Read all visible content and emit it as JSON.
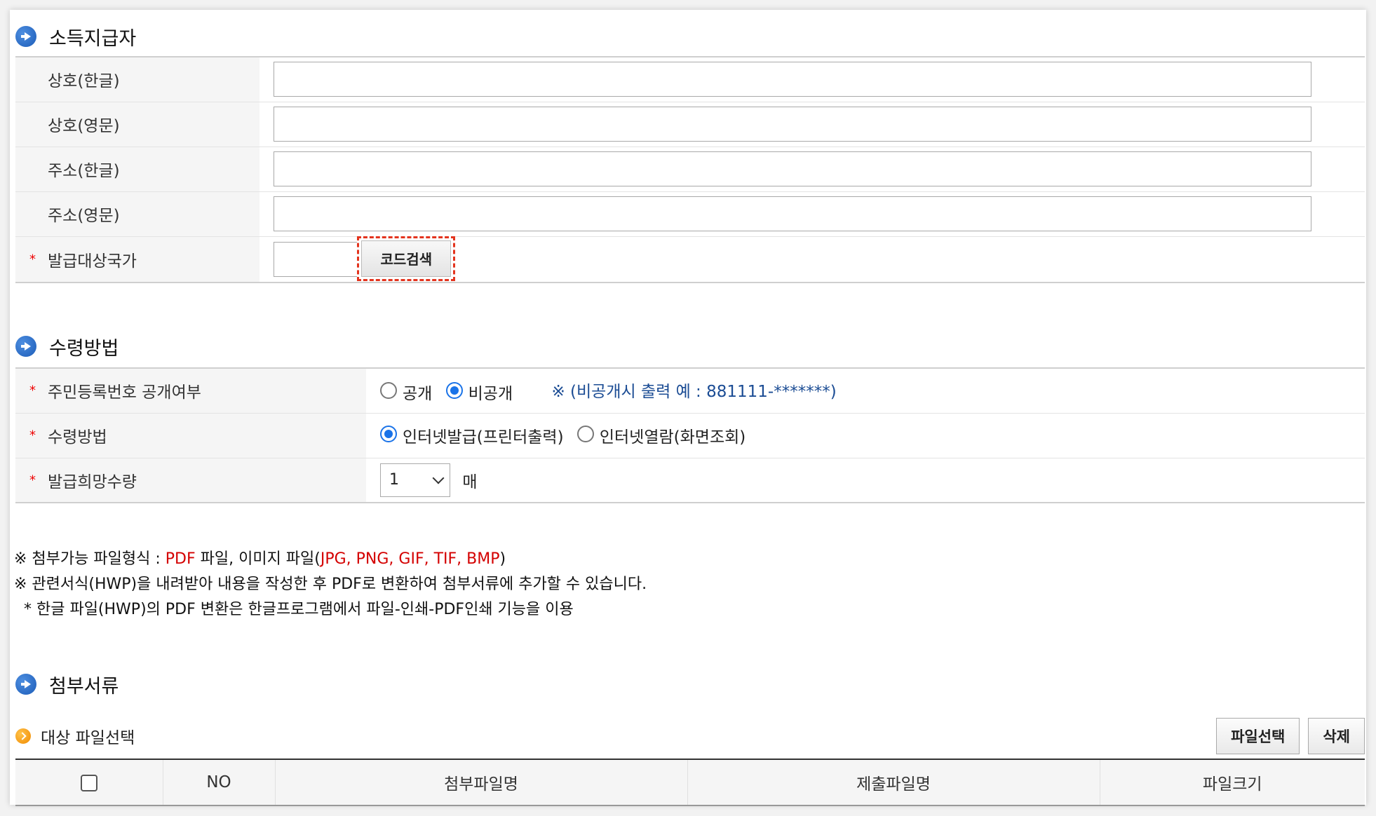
{
  "sections": {
    "payer": "소득지급자",
    "receipt": "수령방법",
    "attach": "첨부서류"
  },
  "payer_form": {
    "name_kr": "상호(한글)",
    "name_en": "상호(영문)",
    "addr_kr": "주소(한글)",
    "addr_en": "주소(영문)",
    "country": "발급대상국가",
    "code_search": "코드검색",
    "required_mark": "*"
  },
  "receipt_form": {
    "id_public_label": "주민등록번호 공개여부",
    "opt_public": "공개",
    "opt_private": "비공개",
    "private_note": "※ (비공개시 출력 예 : 881111-*******)",
    "method_label": "수령방법",
    "opt_internet_issue": "인터넷발급(프린터출력)",
    "opt_internet_view": "인터넷열람(화면조회)",
    "qty_label": "발급희망수량",
    "qty_value": "1",
    "qty_unit": "매"
  },
  "notes": {
    "line1_prefix": "※ 첨부가능 파일형식 : ",
    "line1_pdf": "PDF",
    "line1_mid": " 파일, 이미지 파일(",
    "line1_formats": "JPG, PNG, GIF, TIF, BMP",
    "line1_suffix": ")",
    "line2": "※ 관련서식(HWP)을 내려받아 내용을 작성한 후 PDF로 변환하여 첨부서류에 추가할 수 있습니다.",
    "line3": "  * 한글 파일(HWP)의 PDF 변환은 한글프로그램에서 파일-인쇄-PDF인쇄 기능을 이용"
  },
  "attach": {
    "target_label": "대상 파일선택",
    "select_btn": "파일선택",
    "delete_btn": "삭제",
    "columns": [
      "NO",
      "첨부파일명",
      "제출파일명",
      "파일크기"
    ]
  },
  "colors": {
    "accent_blue": "#1a73e8",
    "required_red": "#e00000",
    "highlight": "#e3341e"
  }
}
